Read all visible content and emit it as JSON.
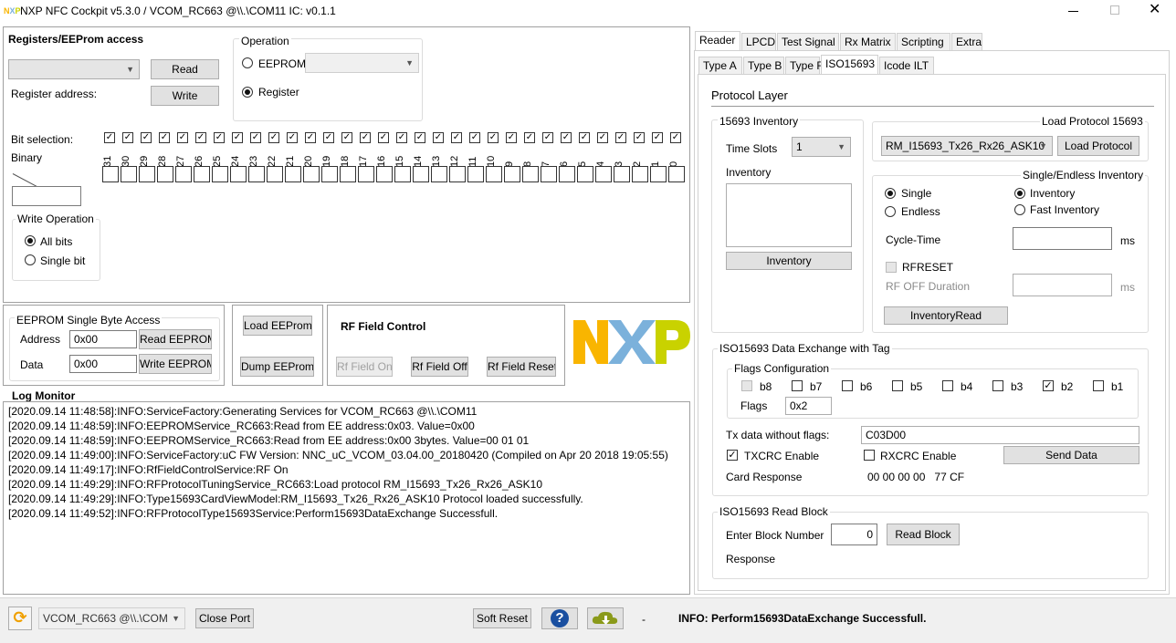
{
  "window": {
    "title": "NXP NFC Cockpit v5.3.0 / VCOM_RC663 @\\\\.\\COM11  IC: v0.1.1"
  },
  "registers": {
    "title": "Registers/EEProm access",
    "read_label": "Read",
    "write_label": "Write",
    "register_address_label": "Register address:",
    "operation_title": "Operation",
    "eeprom_label": "EEPROM",
    "register_label": "Register",
    "bit_selection_label": "Bit selection:",
    "binary_label": "Binary",
    "bits": [
      "31",
      "30",
      "29",
      "28",
      "27",
      "26",
      "25",
      "24",
      "23",
      "22",
      "21",
      "20",
      "19",
      "18",
      "17",
      "16",
      "15",
      "14",
      "13",
      "12",
      "11",
      "10",
      "9",
      "8",
      "7",
      "6",
      "5",
      "4",
      "3",
      "2",
      "1",
      "0"
    ],
    "write_operation_title": "Write Operation",
    "all_bits_label": "All bits",
    "single_bit_label": "Single bit"
  },
  "eeprom_single": {
    "title": "EEPROM Single Byte Access",
    "address_label": "Address",
    "address_value": "0x00",
    "data_label": "Data",
    "data_value": "0x00",
    "read_label": "Read EEPROM",
    "write_label": "Write EEPROM"
  },
  "eeprom_buttons": {
    "load": "Load EEProm",
    "dump": "Dump EEProm"
  },
  "rf_field": {
    "title": "RF Field Control",
    "on": "Rf Field On",
    "off": "Rf Field Off",
    "reset": "Rf Field Reset"
  },
  "logo": {
    "text": "NXP",
    "colors": [
      "#f9b500",
      "#7bb1db",
      "#c9d200"
    ]
  },
  "log": {
    "title": "Log Monitor",
    "lines": [
      "[2020.09.14 11:48:58]:INFO:ServiceFactory:Generating Services for VCOM_RC663 @\\\\.\\COM11",
      "[2020.09.14 11:48:59]:INFO:EEPROMService_RC663:Read from EE address:0x03. Value=0x00",
      "[2020.09.14 11:48:59]:INFO:EEPROMService_RC663:Read from EE address:0x00 3bytes. Value=00 01 01",
      "[2020.09.14 11:49:00]:INFO:ServiceFactory:uC FW Version: NNC_uC_VCOM_03.04.00_20180420 (Compiled on Apr 20 2018 19:05:55)",
      "[2020.09.14 11:49:17]:INFO:RfFieldControlService:RF On",
      "[2020.09.14 11:49:29]:INFO:RFProtocolTuningService_RC663:Load protocol RM_I15693_Tx26_Rx26_ASK10",
      "[2020.09.14 11:49:29]:INFO:Type15693CardViewModel:RM_I15693_Tx26_Rx26_ASK10 Protocol loaded successfully.",
      "[2020.09.14 11:49:52]:INFO:RFProtocolType15693Service:Perform15693DataExchange Successfull."
    ]
  },
  "tabs_top": [
    "Reader",
    "LPCD",
    "Test Signal",
    "Rx Matrix",
    "Scripting",
    "Extra"
  ],
  "tabs_sub": [
    "Type A",
    "Type B",
    "Type F",
    "ISO15693",
    "Icode ILT"
  ],
  "protocol": {
    "title": "Protocol Layer",
    "inventory_group": "15693 Inventory",
    "time_slots_label": "Time Slots",
    "time_slots_value": "1",
    "inventory_label": "Inventory",
    "inventory_button": "Inventory",
    "load_group": "Load Protocol 15693",
    "protocol_value": "RM_I15693_Tx26_Rx26_ASK10",
    "load_button": "Load Protocol",
    "single_endless_group": "Single/Endless Inventory",
    "single_label": "Single",
    "endless_label": "Endless",
    "inv_radio_label": "Inventory",
    "fast_inv_label": "Fast Inventory",
    "cycle_time_label": "Cycle-Time",
    "ms1": "ms",
    "rfreset_label": "RFRESET",
    "rf_off_label": "RF OFF Duration",
    "ms2": "ms",
    "inventory_read_button": "InventoryRead"
  },
  "exchange": {
    "title": "ISO15693 Data Exchange with Tag",
    "flags_group": "Flags Configuration",
    "flags": [
      "b8",
      "b7",
      "b6",
      "b5",
      "b4",
      "b3",
      "b2",
      "b1"
    ],
    "flags_label": "Flags",
    "flags_value": "0x2",
    "tx_label": "Tx data without flags:",
    "tx_value": "C03D00",
    "txcrc_label": "TXCRC Enable",
    "rxcrc_label": "RXCRC Enable",
    "send_button": "Send Data",
    "card_response_label": "Card Response",
    "card_response_value": "00 00 00 00   77 CF"
  },
  "read_block": {
    "title": "ISO15693 Read Block",
    "block_label": "Enter Block Number",
    "block_value": "0",
    "button": "Read Block",
    "response_label": "Response"
  },
  "status": {
    "port_value": "VCOM_RC663 @\\\\.\\COM",
    "close_port": "Close Port",
    "soft_reset": "Soft Reset",
    "dash": "-",
    "message": "INFO: Perform15693DataExchange Successfull."
  }
}
